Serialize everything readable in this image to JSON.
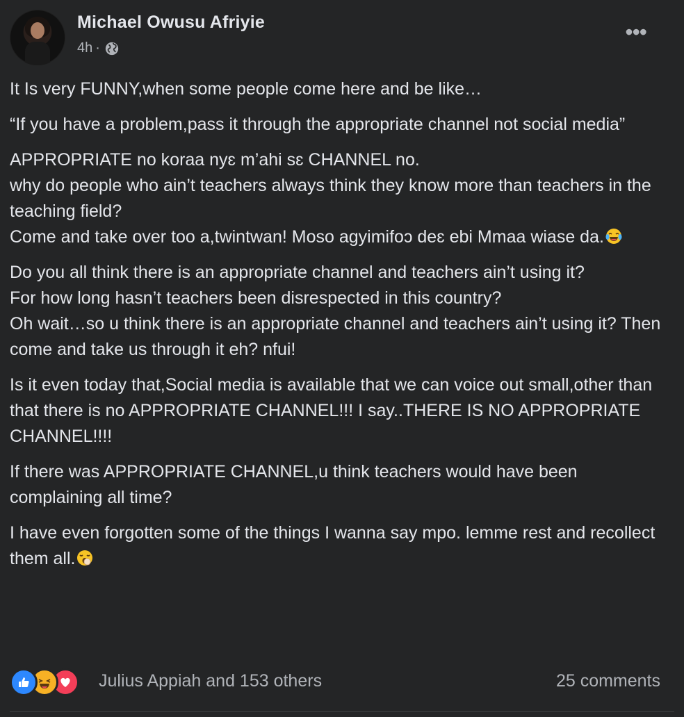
{
  "post": {
    "author": "Michael Owusu Afriyie",
    "time": "4h",
    "separator": "·",
    "visibility_icon": "globe-icon",
    "more_icon": "more-options-icon",
    "paragraphs": [
      {
        "text": "It Is very FUNNY,when some people come here and be like…",
        "emoji": null
      },
      {
        "text": "“If you have a problem,pass it through the appropriate channel not social media”",
        "emoji": null
      },
      {
        "text": "APPROPRIATE no koraa nyɛ m’ahi sɛ CHANNEL no.\nwhy do people who ain’t teachers always think they know more than teachers in the teaching field?\nCome and take over too a,twintwan! Moso agyimifoɔ deɛ ebi Mmaa wiase da.",
        "emoji": "tears-of-joy-emoji"
      },
      {
        "text": "Do you all think there is an appropriate channel and teachers ain’t using it?\nFor how long hasn’t teachers been disrespected in this country?\nOh wait…so u think there is an appropriate channel and teachers ain’t using it? Then come and take us through it eh? nfui!",
        "emoji": null
      },
      {
        "text": "Is it even today that,Social media is available that we can voice out small,other than that there is no APPROPRIATE CHANNEL!!! I say..THERE IS NO APPROPRIATE CHANNEL!!!!",
        "emoji": null
      },
      {
        "text": "If there was APPROPRIATE CHANNEL,u think teachers would have been complaining all time?",
        "emoji": null
      },
      {
        "text": "I have even forgotten some of the things I wanna say mpo. lemme rest and recollect them all.",
        "emoji": "yawning-emoji"
      }
    ],
    "reactions": [
      "like-icon",
      "haha-icon",
      "love-icon"
    ],
    "reactors_text": "Julius Appiah and 153 others",
    "comments_text": "25 comments"
  },
  "colors": {
    "background": "#242526",
    "primary_text": "#e4e6eb",
    "secondary_text": "#b0b3b8",
    "like_blue": "#2d88ff",
    "haha_yellow": "#f7b125",
    "love_red": "#f33e58"
  }
}
